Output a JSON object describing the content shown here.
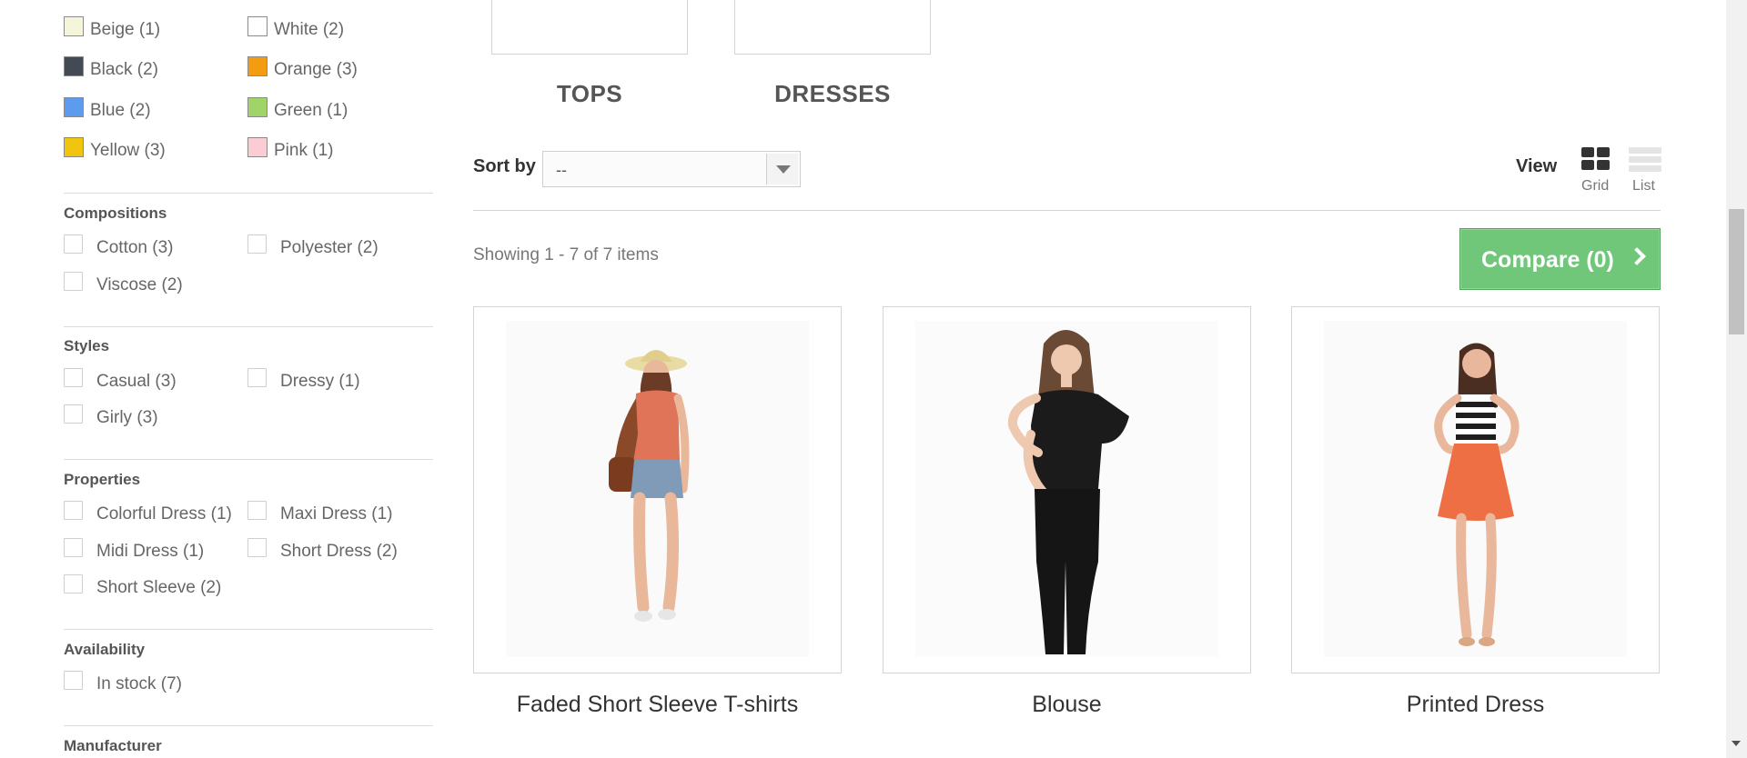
{
  "filters": {
    "colors": [
      {
        "label": "Beige (1)",
        "color": "#f5f5dc"
      },
      {
        "label": "White (2)",
        "color": "#ffffff"
      },
      {
        "label": "Black (2)",
        "color": "#434a54"
      },
      {
        "label": "Orange (3)",
        "color": "#f39c11"
      },
      {
        "label": "Blue (2)",
        "color": "#5d9cec"
      },
      {
        "label": "Green (1)",
        "color": "#a0d468"
      },
      {
        "label": "Yellow (3)",
        "color": "#f1c40f"
      },
      {
        "label": "Pink (1)",
        "color": "#fcccd4"
      }
    ],
    "compositions": {
      "title": "Compositions",
      "items": [
        "Cotton (3)",
        "Polyester (2)",
        "Viscose (2)"
      ]
    },
    "styles": {
      "title": "Styles",
      "items": [
        "Casual (3)",
        "Dressy (1)",
        "Girly (3)"
      ]
    },
    "properties": {
      "title": "Properties",
      "items": [
        "Colorful Dress (1)",
        "Maxi Dress (1)",
        "Midi Dress (1)",
        "Short Dress (2)",
        "Short Sleeve (2)"
      ]
    },
    "availability": {
      "title": "Availability",
      "items": [
        "In stock (7)"
      ]
    },
    "manufacturer": {
      "title": "Manufacturer"
    }
  },
  "subcategories": [
    "TOPS",
    "DRESSES"
  ],
  "toolbar": {
    "sort_label": "Sort by",
    "sort_value": "--",
    "view_label": "View",
    "grid_label": "Grid",
    "list_label": "List"
  },
  "listing": {
    "showing": "Showing 1 - 7 of 7 items",
    "compare_label": "Compare (0)"
  },
  "products": [
    {
      "name": "Faded Short Sleeve T-shirts"
    },
    {
      "name": "Blouse"
    },
    {
      "name": "Printed Dress"
    }
  ]
}
